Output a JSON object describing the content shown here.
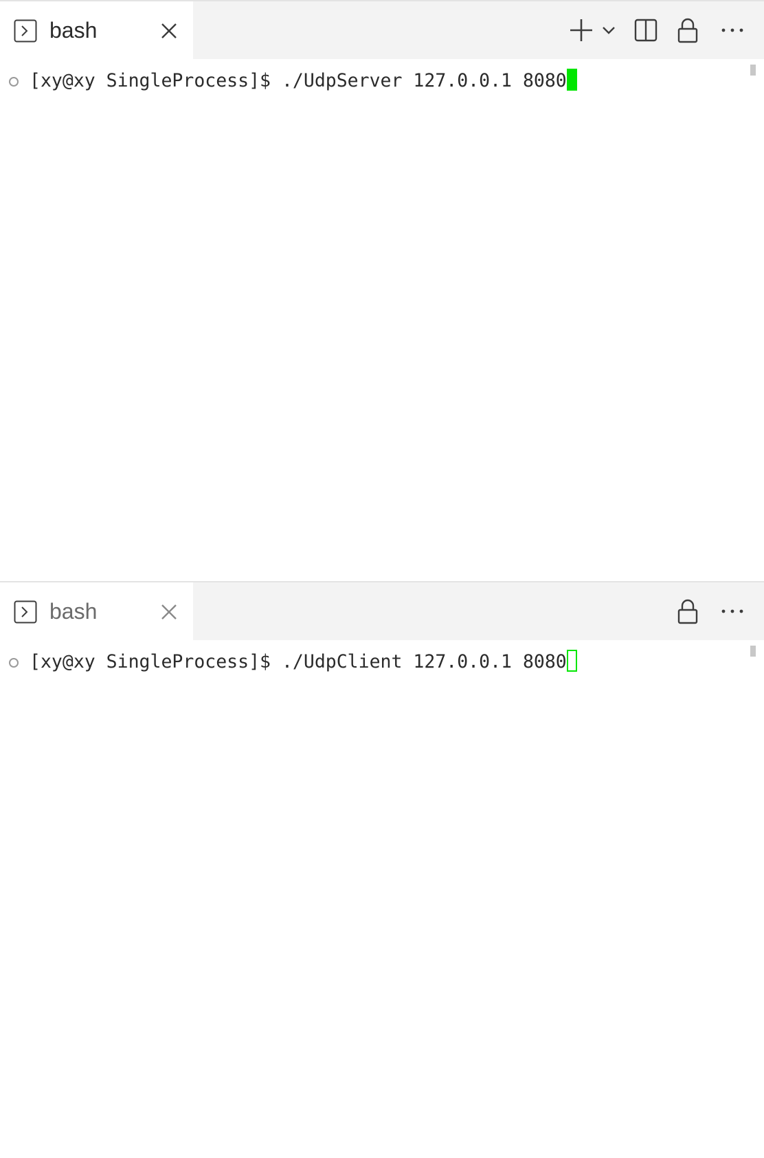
{
  "panes": [
    {
      "tab": {
        "label": "bash",
        "icon": "terminal-icon",
        "active": true
      },
      "toolbar": [
        "plus-icon",
        "chevron-down-icon",
        "split-editor-icon",
        "lock-icon",
        "more-icon"
      ],
      "terminal": {
        "prompt": "[xy@xy SingleProcess]$ ",
        "command": "./UdpServer 127.0.0.1 8080",
        "cursor": "focused"
      }
    },
    {
      "tab": {
        "label": "bash",
        "icon": "terminal-icon",
        "active": false
      },
      "toolbar": [
        "lock-icon",
        "more-icon"
      ],
      "terminal": {
        "prompt": "[xy@xy SingleProcess]$ ",
        "command": "./UdpClient 127.0.0.1 8080",
        "cursor": "unfocused"
      }
    }
  ],
  "colors": {
    "cursor": "#00e600",
    "tabbar_bg": "#f3f3f3",
    "text": "#2b2b2b"
  }
}
